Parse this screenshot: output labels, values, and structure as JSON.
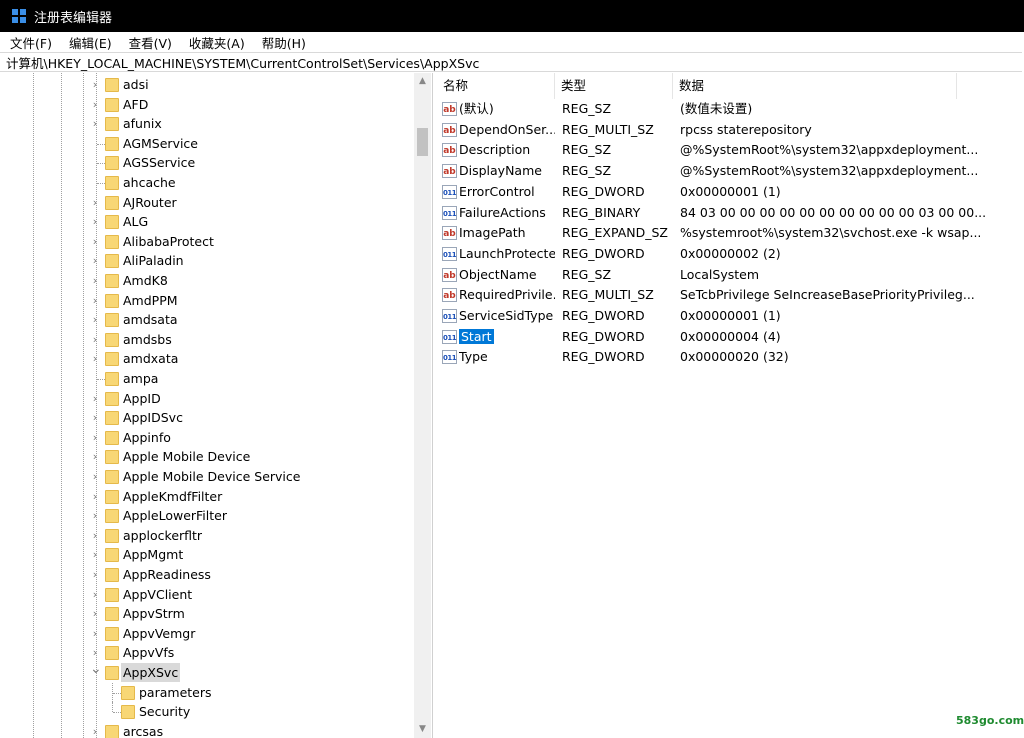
{
  "window": {
    "title": "注册表编辑器"
  },
  "menu": [
    "文件(F)",
    "编辑(E)",
    "查看(V)",
    "收藏夹(A)",
    "帮助(H)"
  ],
  "address": "计算机\\HKEY_LOCAL_MACHINE\\SYSTEM\\CurrentControlSet\\Services\\AppXSvc",
  "tree": {
    "items": [
      {
        "label": "adsi",
        "expandable": true
      },
      {
        "label": "AFD",
        "expandable": true
      },
      {
        "label": "afunix",
        "expandable": true
      },
      {
        "label": "AGMService",
        "expandable": false
      },
      {
        "label": "AGSService",
        "expandable": false
      },
      {
        "label": "ahcache",
        "expandable": false
      },
      {
        "label": "AJRouter",
        "expandable": true
      },
      {
        "label": "ALG",
        "expandable": true
      },
      {
        "label": "AlibabaProtect",
        "expandable": true
      },
      {
        "label": "AliPaladin",
        "expandable": true
      },
      {
        "label": "AmdK8",
        "expandable": true
      },
      {
        "label": "AmdPPM",
        "expandable": true
      },
      {
        "label": "amdsata",
        "expandable": true
      },
      {
        "label": "amdsbs",
        "expandable": true
      },
      {
        "label": "amdxata",
        "expandable": true
      },
      {
        "label": "ampa",
        "expandable": false
      },
      {
        "label": "AppID",
        "expandable": true
      },
      {
        "label": "AppIDSvc",
        "expandable": true
      },
      {
        "label": "Appinfo",
        "expandable": true
      },
      {
        "label": "Apple Mobile Device",
        "expandable": true
      },
      {
        "label": "Apple Mobile Device Service",
        "expandable": true
      },
      {
        "label": "AppleKmdfFilter",
        "expandable": true
      },
      {
        "label": "AppleLowerFilter",
        "expandable": true
      },
      {
        "label": "applockerfltr",
        "expandable": true
      },
      {
        "label": "AppMgmt",
        "expandable": true
      },
      {
        "label": "AppReadiness",
        "expandable": true
      },
      {
        "label": "AppVClient",
        "expandable": true
      },
      {
        "label": "AppvStrm",
        "expandable": true
      },
      {
        "label": "AppvVemgr",
        "expandable": true
      },
      {
        "label": "AppvVfs",
        "expandable": true
      },
      {
        "label": "AppXSvc",
        "expandable": true,
        "expanded": true,
        "selected": true
      },
      {
        "label": "parameters",
        "child": true
      },
      {
        "label": "Security",
        "child": true
      },
      {
        "label": "arcsas",
        "expandable": true
      }
    ]
  },
  "list": {
    "headers": [
      "名称",
      "类型",
      "数据"
    ],
    "rows": [
      {
        "icon": "ab",
        "name": "(默认)",
        "type": "REG_SZ",
        "data": "(数值未设置)"
      },
      {
        "icon": "ab",
        "name": "DependOnSer...",
        "type": "REG_MULTI_SZ",
        "data": "rpcss staterepository"
      },
      {
        "icon": "ab",
        "name": "Description",
        "type": "REG_SZ",
        "data": "@%SystemRoot%\\system32\\appxdeployment..."
      },
      {
        "icon": "ab",
        "name": "DisplayName",
        "type": "REG_SZ",
        "data": "@%SystemRoot%\\system32\\appxdeployment..."
      },
      {
        "icon": "bin",
        "name": "ErrorControl",
        "type": "REG_DWORD",
        "data": "0x00000001 (1)"
      },
      {
        "icon": "bin",
        "name": "FailureActions",
        "type": "REG_BINARY",
        "data": "84 03 00 00 00 00 00 00 00 00 00 00 03 00 00..."
      },
      {
        "icon": "ab",
        "name": "ImagePath",
        "type": "REG_EXPAND_SZ",
        "data": "%systemroot%\\system32\\svchost.exe -k wsap..."
      },
      {
        "icon": "bin",
        "name": "LaunchProtected",
        "type": "REG_DWORD",
        "data": "0x00000002 (2)"
      },
      {
        "icon": "ab",
        "name": "ObjectName",
        "type": "REG_SZ",
        "data": "LocalSystem"
      },
      {
        "icon": "ab",
        "name": "RequiredPrivile...",
        "type": "REG_MULTI_SZ",
        "data": "SeTcbPrivilege SeIncreaseBasePriorityPrivileg..."
      },
      {
        "icon": "bin",
        "name": "ServiceSidType",
        "type": "REG_DWORD",
        "data": "0x00000001 (1)"
      },
      {
        "icon": "bin",
        "name": "Start",
        "type": "REG_DWORD",
        "data": "0x00000004 (4)",
        "selected": true
      },
      {
        "icon": "bin",
        "name": "Type",
        "type": "REG_DWORD",
        "data": "0x00000020 (32)"
      }
    ]
  },
  "watermark": "583go.com",
  "colors": {
    "selection": "#0078d7",
    "folder": "#f8d775",
    "titlebar": "#000000"
  }
}
